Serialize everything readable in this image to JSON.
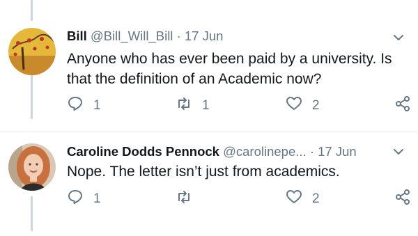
{
  "tweets": [
    {
      "name": "Bill",
      "handle": "@Bill_Will_Bill",
      "dot": "·",
      "time": "17 Jun",
      "text": "Anyone who has ever been paid by a university. Is that the definition of an Academic now?",
      "replies": "1",
      "retweets": "1",
      "likes": "2"
    },
    {
      "name": "Caroline Dodds Pennock",
      "handle": "@carolinepe...",
      "dot": "·",
      "time": "17 Jun",
      "text": "Nope. The letter isn’t just from academics.",
      "replies": "1",
      "retweets": "",
      "likes": "2"
    }
  ],
  "icons": {
    "reply": "reply-icon",
    "retweet": "retweet-icon",
    "like": "heart-icon",
    "share": "share-icon",
    "menu": "chevron-down-icon"
  },
  "colors": {
    "secondary_text": "#657786",
    "thread_line": "#ccd6dd",
    "divider": "#e6ecf0"
  }
}
